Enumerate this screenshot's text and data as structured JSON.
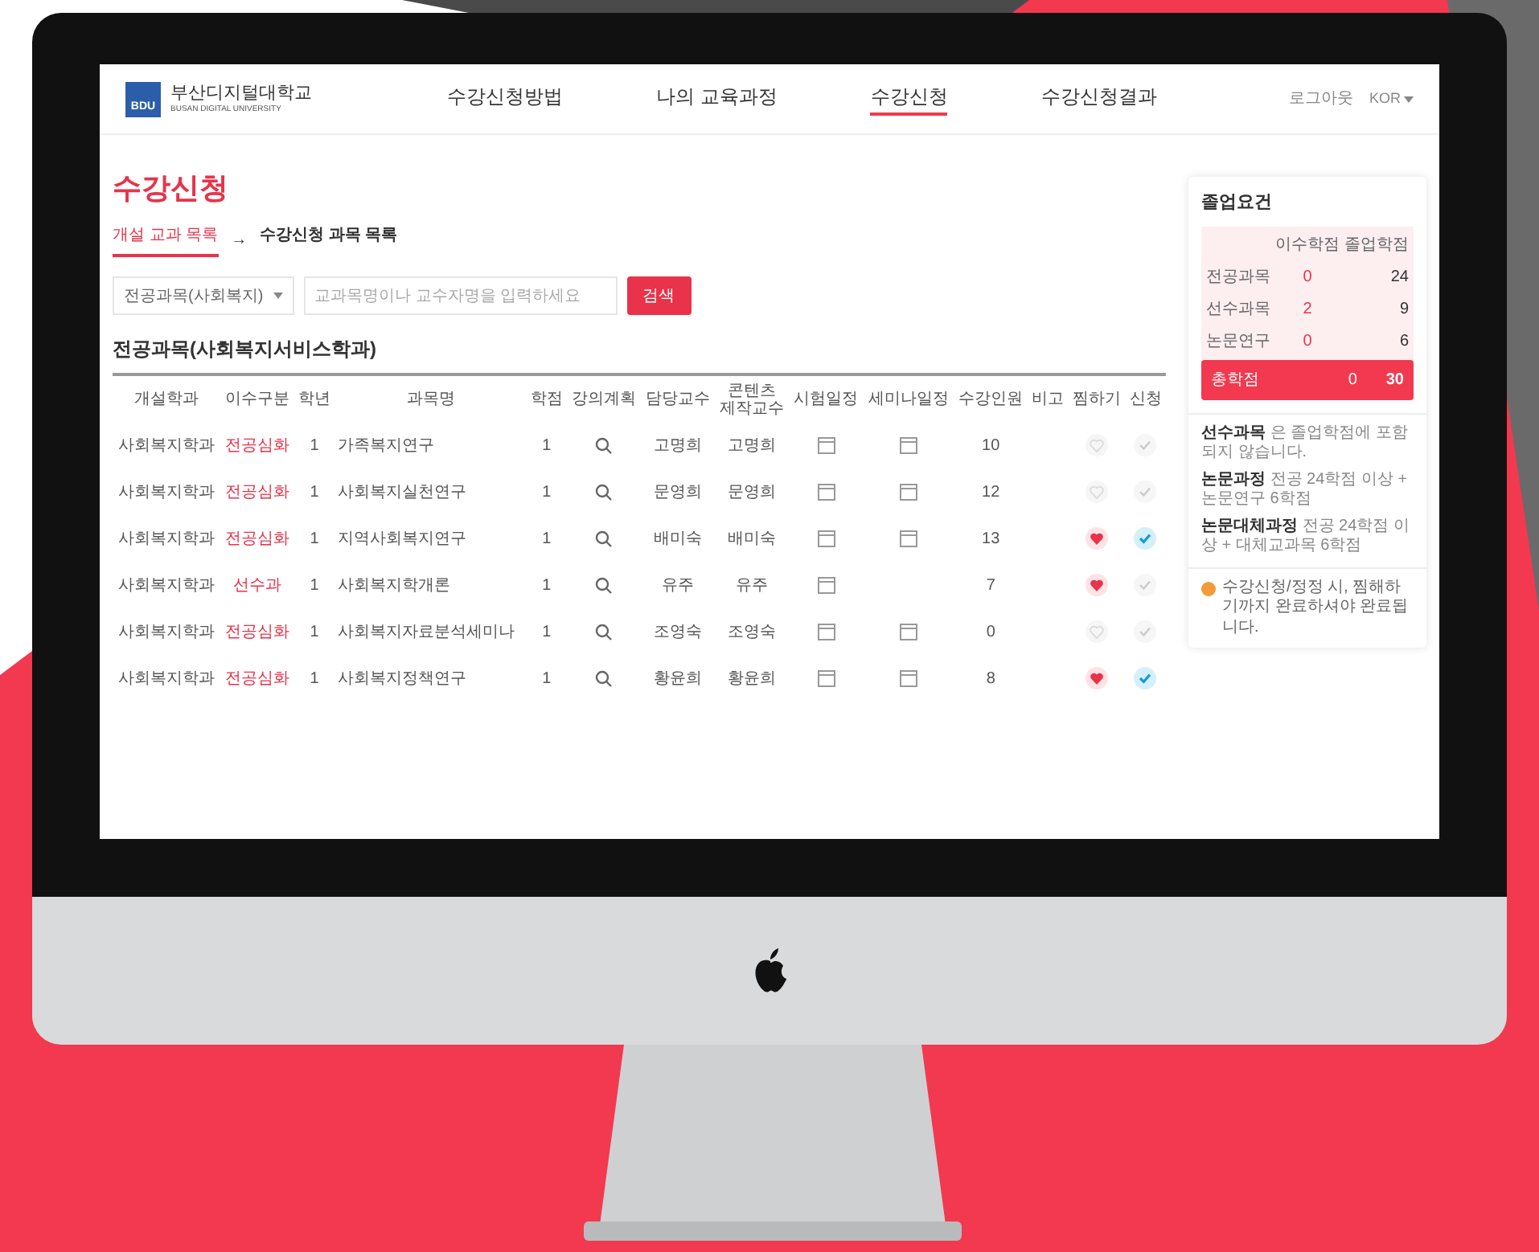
{
  "header": {
    "logo_title": "부산디지털대학교",
    "logo_subtitle": "BUSAN DIGITAL UNIVERSITY",
    "logo_mark": "BDU",
    "nav": [
      {
        "label": "수강신청방법",
        "selected": false
      },
      {
        "label": "나의 교육과정",
        "selected": false
      },
      {
        "label": "수강신청",
        "selected": true
      },
      {
        "label": "수강신청결과",
        "selected": false
      }
    ],
    "logout": "로그아웃",
    "language": "KOR"
  },
  "page_title": "수강신청",
  "steps": [
    {
      "label": "개설 교과 목록",
      "selected": true
    },
    {
      "label": "수강신청 과목 목록",
      "selected": false
    }
  ],
  "step_separator": "→",
  "filter": {
    "category": "전공과목(사회복지)",
    "search_placeholder": "교과목명이나 교수자명을 입력하세요",
    "search_button": "검색"
  },
  "section_title": "전공과목(사회복지서비스학과)",
  "table": {
    "columns": [
      "개설학과",
      "이수구분",
      "학년",
      "과목명",
      "학점",
      "강의계획",
      "담당교수",
      "콘텐츠 제작교수",
      "시험일정",
      "세미나일정",
      "수강인원",
      "비고",
      "찜하기",
      "신청"
    ],
    "rows": [
      {
        "department": "사회복지학과",
        "type": "전공심화",
        "year": "1",
        "course": "가족복지연구",
        "credits": "1",
        "professor": "고명희",
        "content_professor": "고명희",
        "exam_schedule": true,
        "seminar_schedule": true,
        "enrolled": "10",
        "liked": false,
        "applied": false
      },
      {
        "department": "사회복지학과",
        "type": "전공심화",
        "year": "1",
        "course": "사회복지실천연구",
        "credits": "1",
        "professor": "문영희",
        "content_professor": "문영희",
        "exam_schedule": true,
        "seminar_schedule": true,
        "enrolled": "12",
        "liked": false,
        "applied": false
      },
      {
        "department": "사회복지학과",
        "type": "전공심화",
        "year": "1",
        "course": "지역사회복지연구",
        "credits": "1",
        "professor": "배미숙",
        "content_professor": "배미숙",
        "exam_schedule": true,
        "seminar_schedule": true,
        "enrolled": "13",
        "liked": true,
        "applied": true
      },
      {
        "department": "사회복지학과",
        "type": "선수과",
        "year": "1",
        "course": "사회복지학개론",
        "credits": "1",
        "professor": "유주",
        "content_professor": "유주",
        "exam_schedule": true,
        "seminar_schedule": false,
        "enrolled": "7",
        "liked": true,
        "applied": false
      },
      {
        "department": "사회복지학과",
        "type": "전공심화",
        "year": "1",
        "course": "사회복지자료분석세미나",
        "credits": "1",
        "professor": "조영숙",
        "content_professor": "조영숙",
        "exam_schedule": true,
        "seminar_schedule": true,
        "enrolled": "0",
        "liked": false,
        "applied": false
      },
      {
        "department": "사회복지학과",
        "type": "전공심화",
        "year": "1",
        "course": "사회복지정책연구",
        "credits": "1",
        "professor": "황윤희",
        "content_professor": "황윤희",
        "exam_schedule": true,
        "seminar_schedule": true,
        "enrolled": "8",
        "liked": true,
        "applied": true
      }
    ]
  },
  "sidebar": {
    "title": "졸업요건",
    "columns": [
      "이수학점",
      "졸업학점"
    ],
    "rows": [
      {
        "label": "전공과목",
        "earned": "0",
        "required": "24"
      },
      {
        "label": "선수과목",
        "earned": "2",
        "required": "9"
      },
      {
        "label": "논문연구",
        "earned": "0",
        "required": "6"
      }
    ],
    "total": {
      "label": "총학점",
      "earned": "0",
      "required": "30"
    },
    "notes": [
      {
        "term": "선수과목",
        "text": "은 졸업학점에 포함되지 않습니다."
      },
      {
        "term": "논문과정",
        "text": "전공 24학점 이상 + 논문연구 6학점"
      },
      {
        "term": "논문대체과정",
        "text": "전공 24학점 이상 + 대체교과목 6학점"
      }
    ],
    "notice": "수강신청/정정 시, 찜해하기까지 완료하셔야 완료됩니다."
  }
}
